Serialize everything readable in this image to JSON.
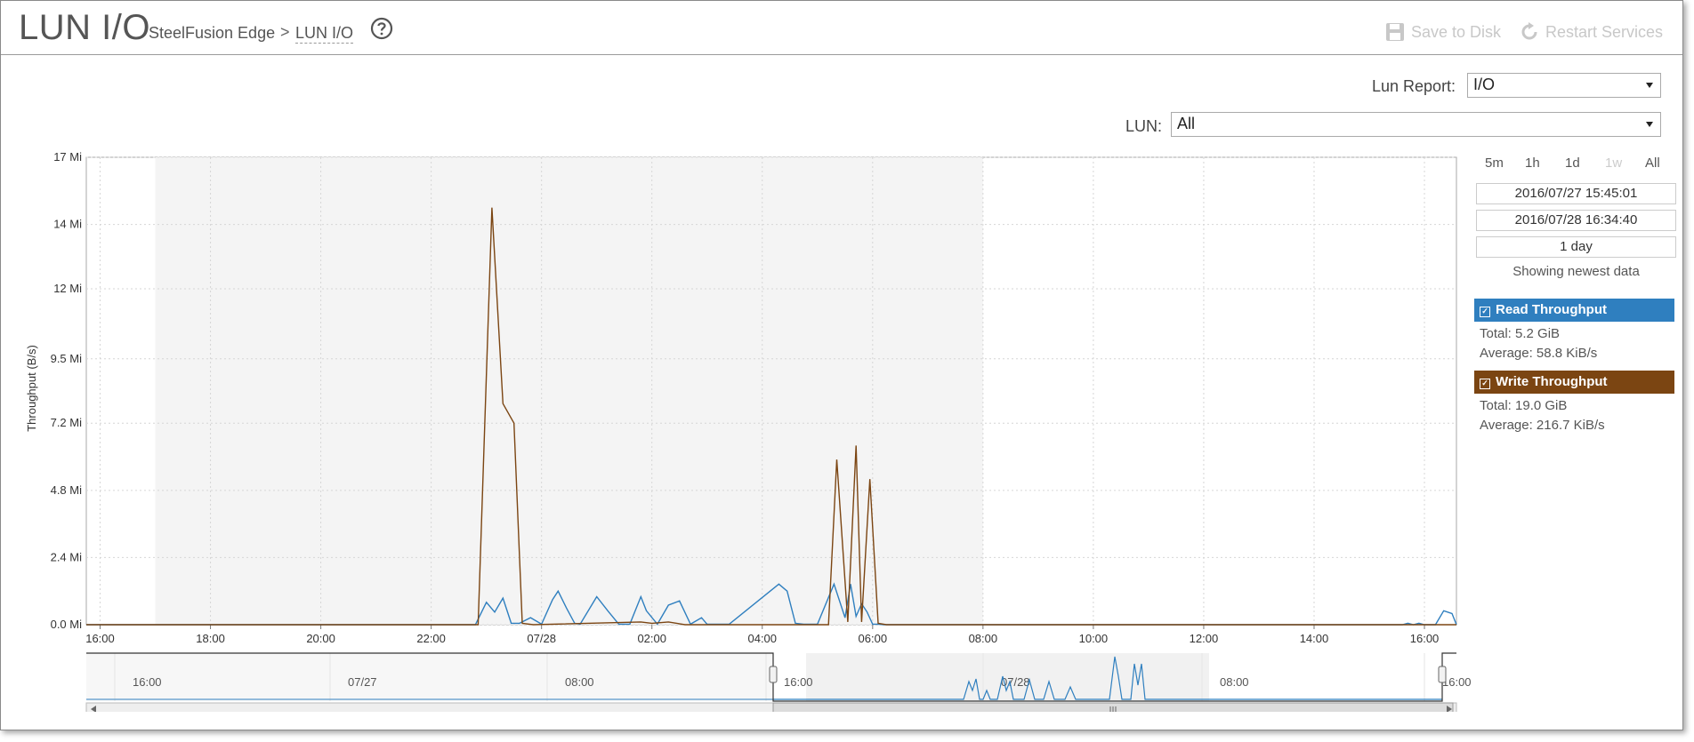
{
  "header": {
    "title": "LUN I/O",
    "breadcrumb": [
      "SteelFusion Edge",
      "LUN I/O"
    ],
    "breadcrumb_separator": ">",
    "save_label": "Save to Disk",
    "restart_label": "Restart Services"
  },
  "controls": {
    "lun_report_label": "Lun Report:",
    "lun_report_value": "I/O",
    "lun_label": "LUN:",
    "lun_value": "All"
  },
  "time_range": {
    "buttons": [
      "5m",
      "1h",
      "1d",
      "1w",
      "All"
    ],
    "disabled": "1w",
    "start": "2016/07/27 15:45:01",
    "end": "2016/07/28 16:34:40",
    "duration": "1 day",
    "status": "Showing newest data"
  },
  "legend": {
    "read": {
      "label": "Read Throughput",
      "total": "Total: 5.2 GiB",
      "average": "Average: 58.8 KiB/s",
      "color": "#2f7fbf"
    },
    "write": {
      "label": "Write Throughput",
      "total": "Total: 19.0 GiB",
      "average": "Average: 216.7 KiB/s",
      "color": "#7b4512"
    }
  },
  "chart_data": {
    "type": "line",
    "ylabel": "Throughput (B/s)",
    "y_ticks": [
      "0.0 Mi",
      "2.4 Mi",
      "4.8 Mi",
      "7.2 Mi",
      "9.5 Mi",
      "12 Mi",
      "14 Mi",
      "17 Mi"
    ],
    "y_tick_values": [
      0,
      2.4,
      4.8,
      7.2,
      9.5,
      12,
      14.3,
      16.7
    ],
    "ylim": [
      0,
      16.7
    ],
    "x_ticks": [
      "16:00",
      "18:00",
      "20:00",
      "22:00",
      "07/28",
      "02:00",
      "04:00",
      "06:00",
      "08:00",
      "10:00",
      "12:00",
      "14:00",
      "16:00"
    ],
    "x_tick_hours": [
      16,
      18,
      20,
      22,
      24,
      26,
      28,
      30,
      32,
      34,
      36,
      38,
      40
    ],
    "xlim_hours": [
      15.75,
      40.58
    ],
    "shaded_hours": [
      17,
      32
    ],
    "grid": true,
    "series": [
      {
        "name": "Read Throughput",
        "color": "#2f7fbf",
        "x_hours": [
          15.75,
          22.8,
          23.0,
          23.15,
          23.3,
          23.45,
          23.6,
          23.8,
          24.0,
          24.2,
          24.3,
          24.45,
          24.6,
          24.7,
          25.0,
          25.2,
          25.4,
          25.6,
          25.8,
          25.9,
          26.1,
          26.3,
          26.5,
          26.7,
          26.9,
          27.0,
          27.2,
          27.4,
          28.3,
          28.45,
          28.6,
          28.75,
          29.0,
          29.3,
          29.5,
          29.6,
          29.7,
          29.8,
          29.9,
          30.0,
          30.1,
          30.2,
          30.4,
          39.6,
          39.7,
          39.8,
          39.9,
          40.0,
          40.2,
          40.35,
          40.5,
          40.58
        ],
        "values_mi": [
          0,
          0,
          0.8,
          0.45,
          0.95,
          0.05,
          0.05,
          0.25,
          0.02,
          0.9,
          1.2,
          0.6,
          0.05,
          0.02,
          1.0,
          0.5,
          0.02,
          0.02,
          1.0,
          0.5,
          0.02,
          0.7,
          0.85,
          0.02,
          0.25,
          0.02,
          0.02,
          0.02,
          1.45,
          1.2,
          0.05,
          0.02,
          0.02,
          1.45,
          0.25,
          1.45,
          0.3,
          0.75,
          0.45,
          0.02,
          0.02,
          0,
          0,
          0,
          0.05,
          0,
          0.05,
          0,
          0,
          0.5,
          0.4,
          0
        ]
      },
      {
        "name": "Write Throughput",
        "color": "#7b4512",
        "x_hours": [
          15.75,
          22.85,
          23.1,
          23.3,
          23.5,
          23.65,
          23.85,
          25.8,
          26.0,
          26.3,
          26.6,
          29.2,
          29.35,
          29.55,
          29.7,
          29.8,
          29.95,
          30.1,
          30.25,
          40.58
        ],
        "values_mi": [
          0,
          0,
          14.9,
          7.9,
          7.2,
          0.05,
          0,
          0.1,
          0.05,
          0.1,
          0,
          0,
          5.9,
          0.1,
          6.4,
          0.1,
          5.2,
          0.05,
          0,
          0
        ]
      }
    ],
    "navigator": {
      "labels": [
        "16:00",
        "07/27",
        "08:00",
        "16:00",
        "07/28",
        "08:00",
        "16:00"
      ]
    }
  }
}
